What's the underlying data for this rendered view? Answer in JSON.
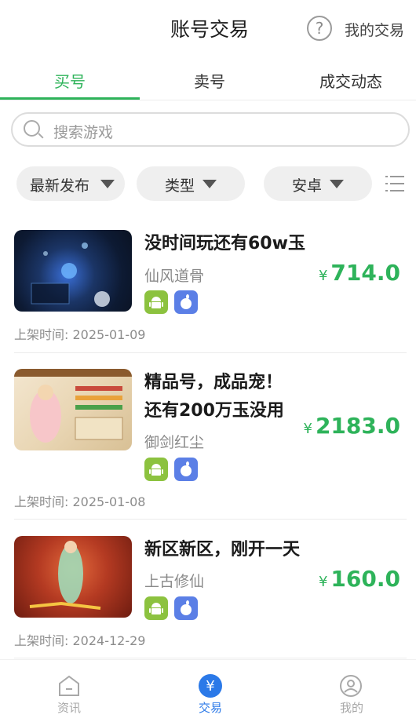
{
  "header": {
    "title": "账号交易",
    "help_icon": "question-circle-icon",
    "my_trades": "我的交易"
  },
  "tabs": [
    {
      "label": "买号",
      "active": true
    },
    {
      "label": "卖号",
      "active": false
    },
    {
      "label": "成交动态",
      "active": false
    }
  ],
  "search": {
    "placeholder": "搜索游戏"
  },
  "filters": [
    {
      "label": "最新发布"
    },
    {
      "label": "类型"
    },
    {
      "label": "安卓"
    }
  ],
  "currency": "¥",
  "listings": [
    {
      "title_lines": [
        "没时间玩还有60w玉"
      ],
      "game": "仙风道骨",
      "price": "714.0",
      "platforms": [
        "android-icon",
        "apple-icon"
      ],
      "listed_at": "上架时间: 2025-01-09"
    },
    {
      "title_lines": [
        "精品号，成品宠！",
        "还有200万玉没用"
      ],
      "game": "御剑红尘",
      "price": "2183.0",
      "platforms": [
        "android-icon",
        "apple-icon"
      ],
      "listed_at": "上架时间: 2025-01-08"
    },
    {
      "title_lines": [
        "新区新区，刚开一天"
      ],
      "game": "上古修仙",
      "price": "160.0",
      "platforms": [
        "android-icon",
        "apple-icon"
      ],
      "listed_at": "上架时间: 2024-12-29"
    }
  ],
  "bottom_nav": [
    {
      "label": "资讯",
      "icon": "news-icon",
      "active": false
    },
    {
      "label": "交易",
      "icon": "trade-yen-icon",
      "active": true
    },
    {
      "label": "我的",
      "icon": "profile-icon",
      "active": false
    }
  ],
  "colors": {
    "accent_green": "#2eb35a",
    "nav_active_blue": "#2b79e8",
    "android_badge": "#8cc23f",
    "apple_badge": "#5b7fe6"
  }
}
